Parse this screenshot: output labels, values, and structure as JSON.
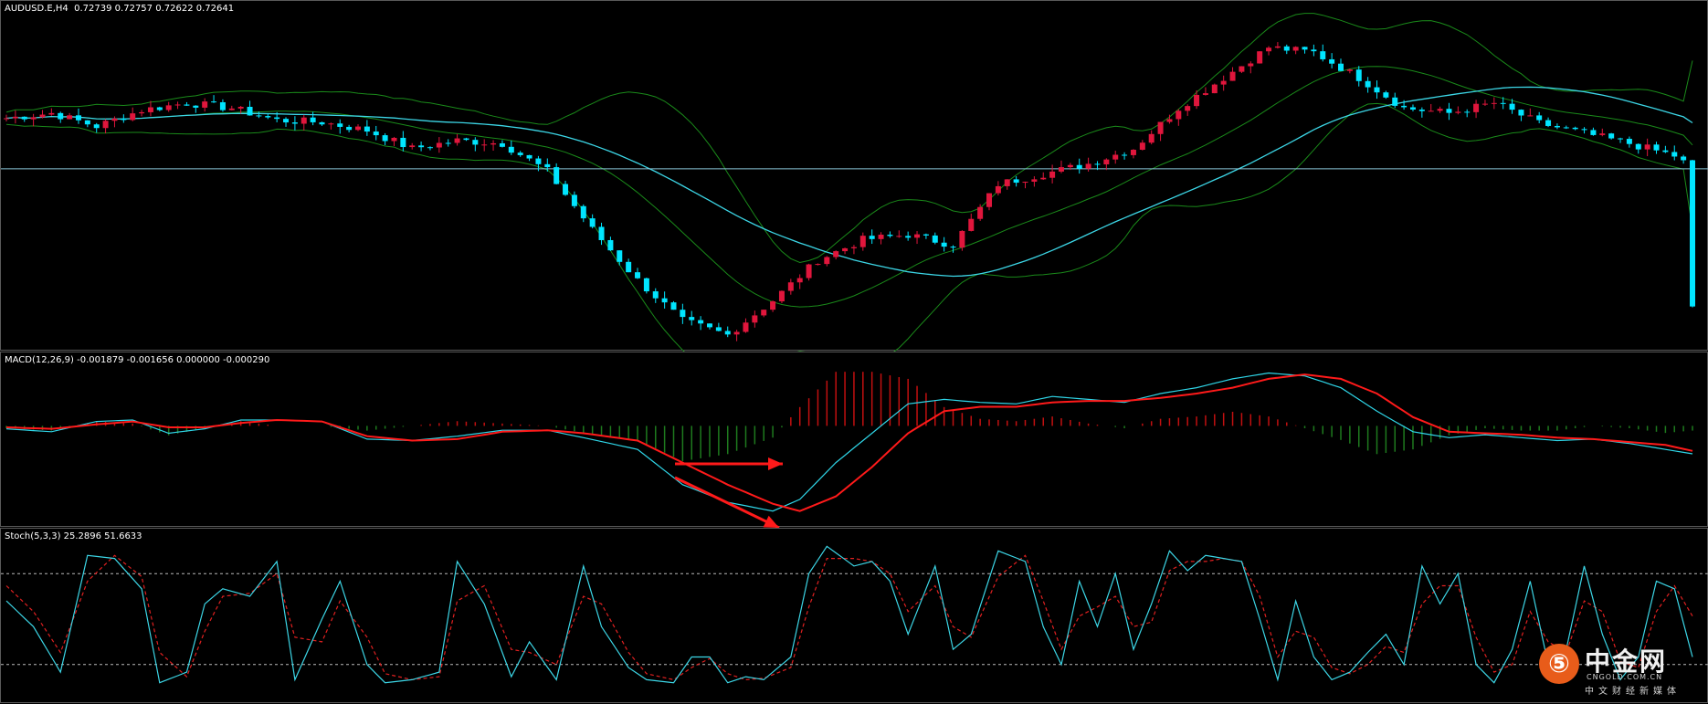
{
  "price_pane": {
    "label": "AUDUSD.E,H4  0.72739 0.72757 0.72622 0.72641"
  },
  "macd_pane": {
    "label": "MACD(12,26,9) -0.001879 -0.001656 0.000000 -0.000290"
  },
  "stoch_pane": {
    "label": "Stoch(5,3,3) 25.2896 51.6633"
  },
  "watermark": {
    "mark": "⑤",
    "name": "中金网",
    "url": "CNGOLD.COM.CN",
    "tagline": "中文财经新媒体"
  },
  "colors": {
    "bull_candle": "#e0163c",
    "bear_candle": "#00e5ff",
    "bands": "#1a8a1a",
    "ma": "#3cd6e6",
    "hline": "#8ac6d8",
    "macd_line": "#2fd6e8",
    "signal_line": "#ff1a1a",
    "hist_pos": "#c21010",
    "hist_neg": "#1e7a1e",
    "stoch_main": "#3cd6e6",
    "stoch_signal": "#e02020",
    "levels": "#bbbbbb",
    "arrow": "#ff1a1a"
  },
  "chart_data": [
    {
      "type": "candlestick",
      "symbol": "AUDUSD.E",
      "timeframe": "H4",
      "last_bar": {
        "open": 0.72739,
        "high": 0.72757,
        "low": 0.72622,
        "close": 0.72641
      },
      "indicators": [
        "Bollinger Bands",
        "Moving Average"
      ],
      "close_path": [
        [
          0,
          0.745
        ],
        [
          5,
          0.7455
        ],
        [
          10,
          0.7442
        ],
        [
          15,
          0.7458
        ],
        [
          20,
          0.7465
        ],
        [
          25,
          0.746
        ],
        [
          30,
          0.7448
        ],
        [
          35,
          0.7446
        ],
        [
          40,
          0.7438
        ],
        [
          45,
          0.742
        ],
        [
          50,
          0.7428
        ],
        [
          55,
          0.7425
        ],
        [
          60,
          0.7398
        ],
        [
          65,
          0.734
        ],
        [
          70,
          0.729
        ],
        [
          75,
          0.725
        ],
        [
          80,
          0.7236
        ],
        [
          85,
          0.727
        ],
        [
          90,
          0.731
        ],
        [
          95,
          0.733
        ],
        [
          100,
          0.7335
        ],
        [
          105,
          0.7325
        ],
        [
          110,
          0.7385
        ],
        [
          115,
          0.7395
        ],
        [
          120,
          0.7405
        ],
        [
          125,
          0.742
        ],
        [
          130,
          0.746
        ],
        [
          135,
          0.749
        ],
        [
          140,
          0.752
        ],
        [
          145,
          0.7515
        ],
        [
          150,
          0.749
        ],
        [
          155,
          0.746
        ],
        [
          160,
          0.7455
        ],
        [
          165,
          0.7465
        ],
        [
          170,
          0.7445
        ],
        [
          175,
          0.7435
        ],
        [
          180,
          0.7425
        ],
        [
          185,
          0.7413
        ],
        [
          187,
          0.74
        ]
      ],
      "horizontal_line": 0.74
    },
    {
      "type": "line",
      "name": "MACD(12,26,9)",
      "values": {
        "macd": -0.001879,
        "signal": -0.001656,
        "histogram": -0.00029
      },
      "macd_path": [
        [
          0,
          -0.0002
        ],
        [
          5,
          -0.0004
        ],
        [
          10,
          0.0003
        ],
        [
          14,
          0.0004
        ],
        [
          18,
          -0.0005
        ],
        [
          22,
          -0.0002
        ],
        [
          26,
          0.0004
        ],
        [
          30,
          0.0004
        ],
        [
          35,
          0.0003
        ],
        [
          40,
          -0.0009
        ],
        [
          45,
          -0.001
        ],
        [
          50,
          -0.0007
        ],
        [
          55,
          -0.0003
        ],
        [
          60,
          -0.0003
        ],
        [
          64,
          -0.0008
        ],
        [
          70,
          -0.0016
        ],
        [
          75,
          -0.004
        ],
        [
          80,
          -0.0052
        ],
        [
          85,
          -0.0058
        ],
        [
          88,
          -0.005
        ],
        [
          92,
          -0.0025
        ],
        [
          96,
          -0.0005
        ],
        [
          100,
          0.0015
        ],
        [
          104,
          0.0018
        ],
        [
          108,
          0.0016
        ],
        [
          112,
          0.0015
        ],
        [
          116,
          0.002
        ],
        [
          120,
          0.0018
        ],
        [
          124,
          0.0016
        ],
        [
          128,
          0.0022
        ],
        [
          132,
          0.0026
        ],
        [
          136,
          0.0032
        ],
        [
          140,
          0.0036
        ],
        [
          144,
          0.0034
        ],
        [
          148,
          0.0026
        ],
        [
          152,
          0.001
        ],
        [
          156,
          -0.0004
        ],
        [
          160,
          -0.0008
        ],
        [
          164,
          -0.0006
        ],
        [
          168,
          -0.0008
        ],
        [
          172,
          -0.001
        ],
        [
          176,
          -0.0009
        ],
        [
          180,
          -0.0012
        ],
        [
          184,
          -0.0016
        ],
        [
          187,
          -0.0019
        ]
      ],
      "signal_path": [
        [
          0,
          -0.0001
        ],
        [
          5,
          -0.0002
        ],
        [
          10,
          0.0001
        ],
        [
          14,
          0.0003
        ],
        [
          18,
          -0.0001
        ],
        [
          22,
          -0.0001
        ],
        [
          26,
          0.0002
        ],
        [
          30,
          0.0004
        ],
        [
          35,
          0.0003
        ],
        [
          40,
          -0.0007
        ],
        [
          45,
          -0.001
        ],
        [
          50,
          -0.0009
        ],
        [
          55,
          -0.0004
        ],
        [
          60,
          -0.0003
        ],
        [
          64,
          -0.0005
        ],
        [
          70,
          -0.001
        ],
        [
          75,
          -0.0025
        ],
        [
          80,
          -0.004
        ],
        [
          85,
          -0.0053
        ],
        [
          88,
          -0.0058
        ],
        [
          92,
          -0.0048
        ],
        [
          96,
          -0.0028
        ],
        [
          100,
          -0.0005
        ],
        [
          104,
          0.001
        ],
        [
          108,
          0.0013
        ],
        [
          112,
          0.0013
        ],
        [
          116,
          0.0016
        ],
        [
          120,
          0.0017
        ],
        [
          124,
          0.0017
        ],
        [
          128,
          0.0019
        ],
        [
          132,
          0.0022
        ],
        [
          136,
          0.0026
        ],
        [
          140,
          0.0032
        ],
        [
          144,
          0.0035
        ],
        [
          148,
          0.0032
        ],
        [
          152,
          0.0022
        ],
        [
          156,
          0.0006
        ],
        [
          160,
          -0.0004
        ],
        [
          164,
          -0.0005
        ],
        [
          168,
          -0.0006
        ],
        [
          172,
          -0.0008
        ],
        [
          176,
          -0.0009
        ],
        [
          180,
          -0.0011
        ],
        [
          184,
          -0.0013
        ],
        [
          187,
          -0.0017
        ]
      ],
      "annotations": [
        "arrow",
        "arrow"
      ]
    },
    {
      "type": "line",
      "name": "Stoch(5,3,3)",
      "values": {
        "main": 25.2896,
        "signal": 51.6633
      },
      "levels": [
        80,
        20
      ],
      "ylim": [
        0,
        100
      ],
      "main_path": [
        [
          0,
          62
        ],
        [
          3,
          45
        ],
        [
          6,
          15
        ],
        [
          9,
          92
        ],
        [
          12,
          90
        ],
        [
          15,
          70
        ],
        [
          17,
          8
        ],
        [
          20,
          15
        ],
        [
          22,
          60
        ],
        [
          24,
          70
        ],
        [
          27,
          65
        ],
        [
          30,
          88
        ],
        [
          32,
          10
        ],
        [
          35,
          50
        ],
        [
          37,
          75
        ],
        [
          40,
          20
        ],
        [
          42,
          8
        ],
        [
          45,
          10
        ],
        [
          48,
          15
        ],
        [
          50,
          88
        ],
        [
          53,
          60
        ],
        [
          56,
          12
        ],
        [
          58,
          35
        ],
        [
          61,
          10
        ],
        [
          64,
          85
        ],
        [
          66,
          45
        ],
        [
          69,
          18
        ],
        [
          71,
          10
        ],
        [
          74,
          8
        ],
        [
          76,
          25
        ],
        [
          78,
          25
        ],
        [
          80,
          8
        ],
        [
          82,
          12
        ],
        [
          84,
          10
        ],
        [
          87,
          25
        ],
        [
          89,
          80
        ],
        [
          91,
          98
        ],
        [
          94,
          85
        ],
        [
          96,
          88
        ],
        [
          98,
          75
        ],
        [
          100,
          40
        ],
        [
          103,
          85
        ],
        [
          105,
          30
        ],
        [
          107,
          40
        ],
        [
          110,
          95
        ],
        [
          113,
          88
        ],
        [
          115,
          45
        ],
        [
          117,
          20
        ],
        [
          119,
          75
        ],
        [
          121,
          45
        ],
        [
          123,
          80
        ],
        [
          125,
          30
        ],
        [
          127,
          60
        ],
        [
          129,
          95
        ],
        [
          131,
          82
        ],
        [
          133,
          92
        ],
        [
          135,
          90
        ],
        [
          137,
          88
        ],
        [
          139,
          50
        ],
        [
          141,
          10
        ],
        [
          143,
          62
        ],
        [
          145,
          25
        ],
        [
          147,
          10
        ],
        [
          149,
          15
        ],
        [
          151,
          28
        ],
        [
          153,
          40
        ],
        [
          155,
          20
        ],
        [
          157,
          85
        ],
        [
          159,
          60
        ],
        [
          161,
          80
        ],
        [
          163,
          20
        ],
        [
          165,
          8
        ],
        [
          167,
          30
        ],
        [
          169,
          75
        ],
        [
          171,
          20
        ],
        [
          173,
          30
        ],
        [
          175,
          85
        ],
        [
          177,
          40
        ],
        [
          179,
          10
        ],
        [
          181,
          25
        ],
        [
          183,
          75
        ],
        [
          185,
          70
        ],
        [
          187,
          25
        ]
      ],
      "signal_path": [
        [
          0,
          72
        ],
        [
          3,
          55
        ],
        [
          6,
          28
        ],
        [
          9,
          75
        ],
        [
          12,
          92
        ],
        [
          15,
          78
        ],
        [
          17,
          28
        ],
        [
          20,
          12
        ],
        [
          22,
          42
        ],
        [
          24,
          65
        ],
        [
          27,
          67
        ],
        [
          30,
          80
        ],
        [
          32,
          38
        ],
        [
          35,
          35
        ],
        [
          37,
          62
        ],
        [
          40,
          38
        ],
        [
          42,
          14
        ],
        [
          45,
          10
        ],
        [
          48,
          12
        ],
        [
          50,
          62
        ],
        [
          53,
          72
        ],
        [
          56,
          30
        ],
        [
          58,
          28
        ],
        [
          61,
          20
        ],
        [
          64,
          65
        ],
        [
          66,
          60
        ],
        [
          69,
          28
        ],
        [
          71,
          14
        ],
        [
          74,
          10
        ],
        [
          76,
          18
        ],
        [
          78,
          24
        ],
        [
          80,
          14
        ],
        [
          82,
          10
        ],
        [
          84,
          11
        ],
        [
          87,
          18
        ],
        [
          89,
          58
        ],
        [
          91,
          90
        ],
        [
          94,
          90
        ],
        [
          96,
          88
        ],
        [
          98,
          80
        ],
        [
          100,
          55
        ],
        [
          103,
          72
        ],
        [
          105,
          45
        ],
        [
          107,
          38
        ],
        [
          110,
          78
        ],
        [
          113,
          92
        ],
        [
          115,
          62
        ],
        [
          117,
          30
        ],
        [
          119,
          52
        ],
        [
          121,
          58
        ],
        [
          123,
          65
        ],
        [
          125,
          45
        ],
        [
          127,
          48
        ],
        [
          129,
          82
        ],
        [
          131,
          88
        ],
        [
          133,
          88
        ],
        [
          135,
          90
        ],
        [
          137,
          88
        ],
        [
          139,
          65
        ],
        [
          141,
          25
        ],
        [
          143,
          42
        ],
        [
          145,
          38
        ],
        [
          147,
          18
        ],
        [
          149,
          14
        ],
        [
          151,
          20
        ],
        [
          153,
          32
        ],
        [
          155,
          28
        ],
        [
          157,
          60
        ],
        [
          159,
          72
        ],
        [
          161,
          72
        ],
        [
          163,
          38
        ],
        [
          165,
          15
        ],
        [
          167,
          20
        ],
        [
          169,
          55
        ],
        [
          171,
          35
        ],
        [
          173,
          28
        ],
        [
          175,
          62
        ],
        [
          177,
          55
        ],
        [
          179,
          22
        ],
        [
          181,
          18
        ],
        [
          183,
          55
        ],
        [
          185,
          72
        ],
        [
          187,
          52
        ]
      ]
    }
  ]
}
